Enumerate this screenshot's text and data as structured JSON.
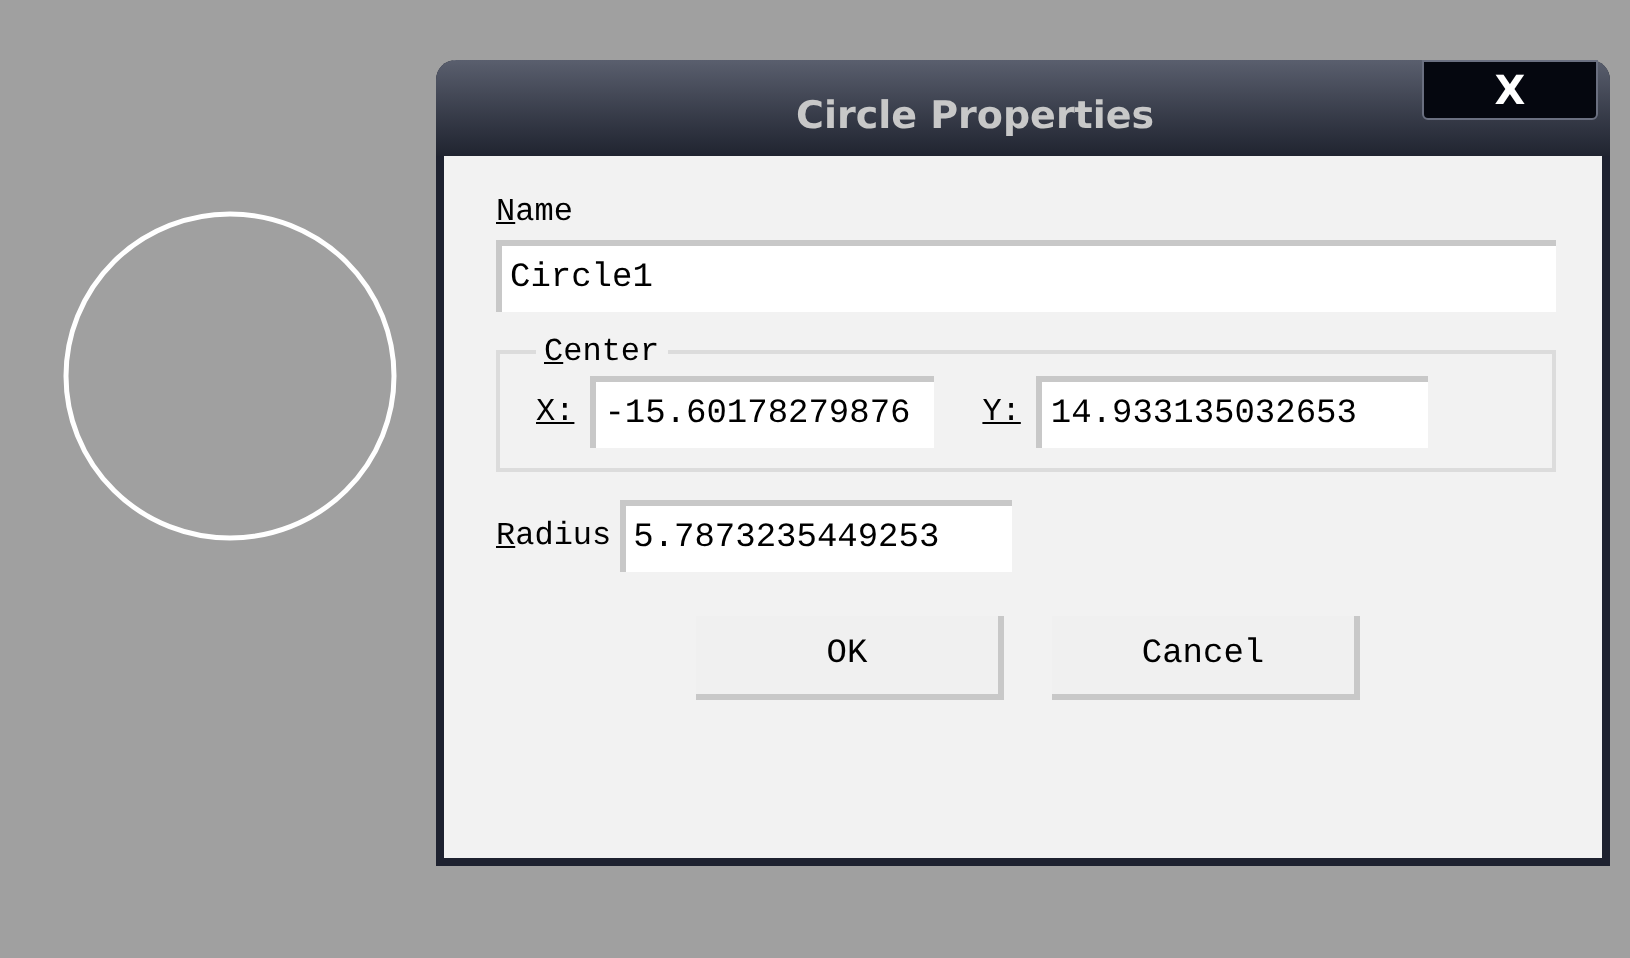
{
  "dialog": {
    "title": "Circle Properties",
    "close_label": "X"
  },
  "name_field": {
    "label": "Name",
    "value": "Circle1"
  },
  "center": {
    "legend": "Center",
    "x": {
      "label": "X:",
      "value": "-15.60178279876"
    },
    "y": {
      "label": "Y:",
      "value": "14.933135032653"
    }
  },
  "radius_field": {
    "label": "Radius",
    "value": "5.7873235449253"
  },
  "buttons": [
    "OK",
    "Cancel"
  ]
}
